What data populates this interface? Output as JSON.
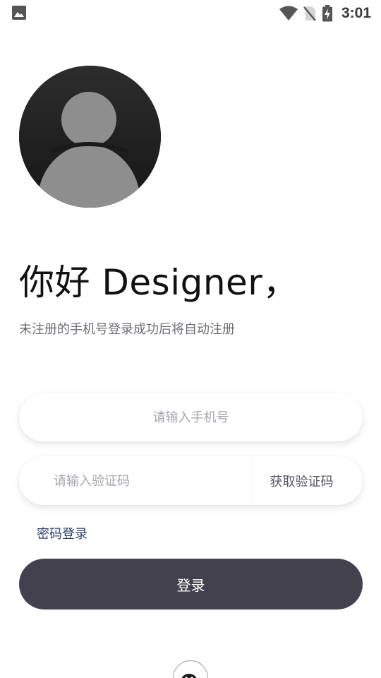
{
  "status_bar": {
    "time": "3:01",
    "left_icon": "image-icon",
    "icons": [
      "wifi-icon",
      "no-sim-icon",
      "battery-charging-icon"
    ]
  },
  "greeting": "你好 Designer，",
  "subtitle": "未注册的手机号登录成功后将自动注册",
  "phone_input": {
    "placeholder": "请输入手机号",
    "value": ""
  },
  "code_input": {
    "placeholder": "请输入验证码",
    "value": ""
  },
  "get_code_label": "获取验证码",
  "password_login_label": "密码登录",
  "login_label": "登录",
  "third_party_icon": "wechat-icon",
  "colors": {
    "primary_button": "#43414d",
    "link": "#2f4370",
    "subtitle": "#6d6d74",
    "placeholder": "#a6a6ad"
  }
}
